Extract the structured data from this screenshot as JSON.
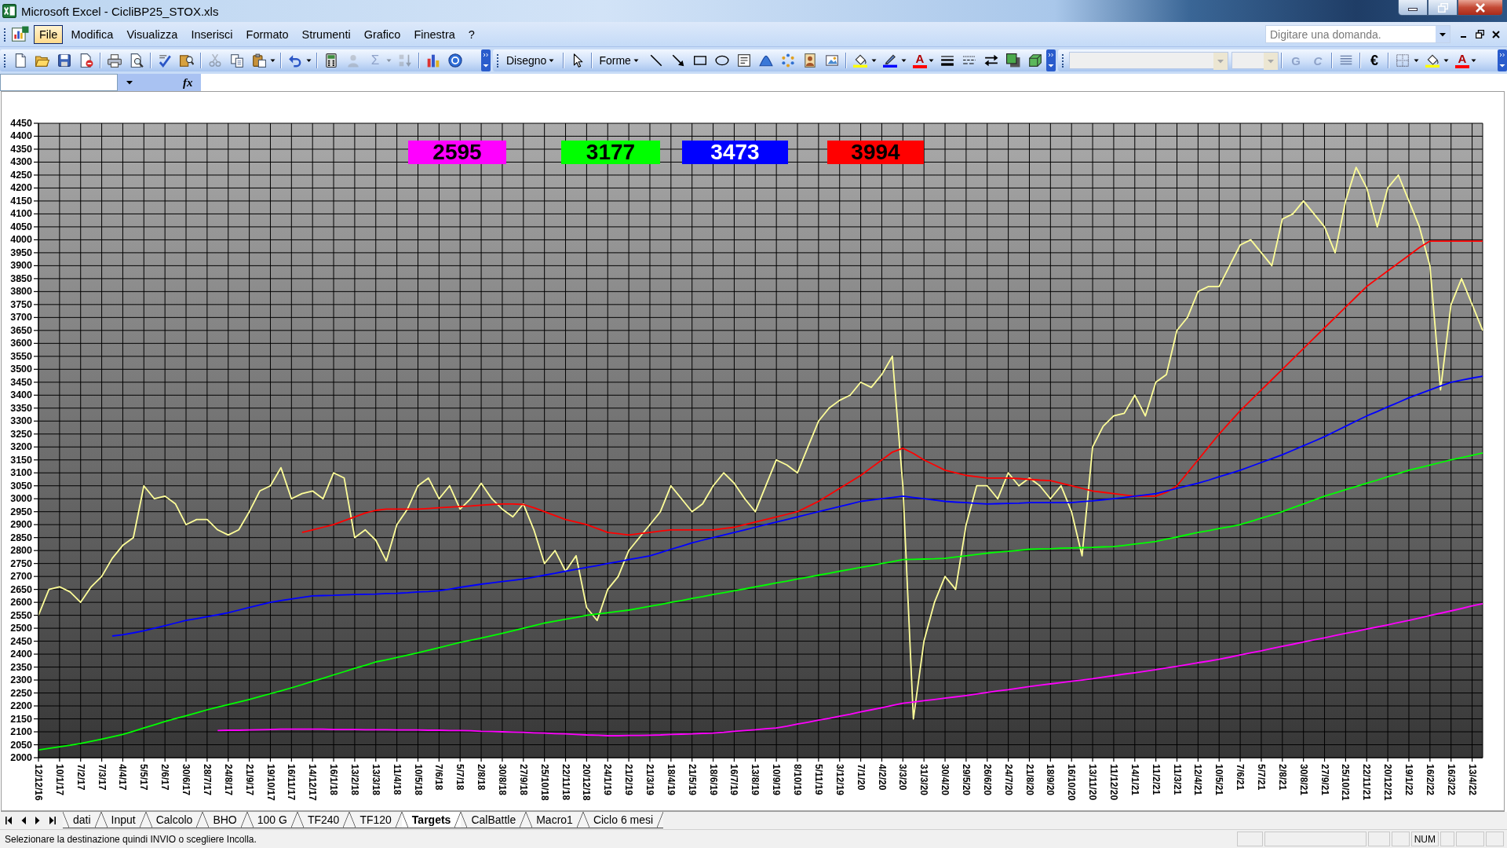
{
  "window": {
    "title": "Microsoft Excel - CicliBP25_STOX.xls"
  },
  "menu_bar": {
    "items": [
      {
        "label": "File",
        "selected": true
      },
      {
        "label": "Modifica",
        "selected": false
      },
      {
        "label": "Visualizza",
        "selected": false
      },
      {
        "label": "Inserisci",
        "selected": false
      },
      {
        "label": "Formato",
        "selected": false
      },
      {
        "label": "Strumenti",
        "selected": false
      },
      {
        "label": "Grafico",
        "selected": false
      },
      {
        "label": "Finestra",
        "selected": false
      },
      {
        "label": "?",
        "selected": false
      }
    ],
    "help_search": {
      "placeholder": "Digitare una domanda."
    }
  },
  "standard_toolbar": {
    "buttons": [
      {
        "disabled": false
      },
      {
        "disabled": false
      },
      {
        "disabled": false
      },
      {
        "disabled": false
      },
      {
        "disabled": false
      },
      {
        "disabled": false
      },
      {
        "disabled": false
      },
      {
        "disabled": false
      },
      {
        "disabled": true
      },
      {
        "disabled": false
      },
      {
        "disabled": false
      },
      {
        "disabled": false
      },
      {
        "disabled": false
      },
      {
        "disabled": false
      },
      {
        "disabled": false
      },
      {
        "disabled": true
      },
      {
        "text": "Σ",
        "disabled": true
      },
      {
        "disabled": true
      },
      {
        "disabled": true
      },
      {
        "disabled": false
      },
      {
        "disabled": false
      }
    ]
  },
  "drawing_toolbar": {
    "draw_menu": "Disegno",
    "shapes_menu": "Forme",
    "font_color": "A"
  },
  "formatting_toolbar": {
    "font_name": {
      "disabled": true
    },
    "font_size": {
      "disabled": true
    },
    "bold": {
      "text": "G",
      "disabled": true
    },
    "italic": {
      "text": "C",
      "disabled": true
    },
    "euro": "€",
    "font_color": "A"
  },
  "formula_bar": {
    "function_label": "fx"
  },
  "chart": {
    "value_tags": [
      {
        "text": "2595",
        "color": "#ff00ff"
      },
      {
        "text": "3177",
        "color": "#00ff00"
      },
      {
        "text": "3473",
        "color": "#0000ff"
      },
      {
        "text": "3994",
        "color": "#ff0000"
      }
    ],
    "chart_data": {
      "type": "line",
      "grid": true,
      "ylim": [
        2000,
        4450
      ],
      "categories": [
        "12/12/16",
        null,
        "10/1/17",
        null,
        "7/2/17",
        null,
        "7/3/17",
        null,
        "4/4/17",
        null,
        "5/5/17",
        null,
        "2/6/17",
        null,
        "30/6/17",
        null,
        "28/7/17",
        null,
        "24/8/17",
        null,
        "21/9/17",
        null,
        "19/10/17",
        null,
        "16/11/17",
        null,
        "14/12/17",
        null,
        "16/1/18",
        null,
        "13/2/18",
        null,
        "13/3/18",
        null,
        "11/4/18",
        null,
        "10/5/18",
        null,
        "7/6/18",
        null,
        "5/7/18",
        null,
        "2/8/18",
        null,
        "30/8/18",
        null,
        "27/9/18",
        null,
        "25/10/18",
        null,
        "22/11/18",
        null,
        "20/12/18",
        null,
        "24/1/19",
        null,
        "21/2/19",
        null,
        "21/3/19",
        null,
        "18/4/19",
        null,
        "21/5/19",
        null,
        "18/6/19",
        null,
        "16/7/19",
        null,
        "13/8/19",
        null,
        "10/9/19",
        null,
        "8/10/19",
        null,
        "5/11/19",
        null,
        "3/12/19",
        null,
        "7/1/20",
        null,
        "4/2/20",
        null,
        "3/3/20",
        null,
        "31/3/20",
        null,
        "30/4/20",
        null,
        "29/5/20",
        null,
        "26/6/20",
        null,
        "24/7/20",
        null,
        "21/8/20",
        null,
        "18/9/20",
        null,
        "16/10/20",
        null,
        "13/11/20",
        null,
        "11/12/20",
        null,
        "14/1/21",
        null,
        "11/2/21",
        null,
        "11/3/21",
        null,
        "12/4/21",
        null,
        "10/5/21",
        null,
        "7/6/21",
        null,
        "5/7/21",
        null,
        "2/8/21",
        null,
        "30/8/21",
        null,
        "27/9/21",
        null,
        "25/10/21",
        null,
        "22/11/21",
        null,
        "20/12/21",
        null,
        "19/1/22",
        null,
        "16/2/22",
        null,
        "16/3/22",
        null,
        "13/4/22",
        null
      ],
      "yticks": [
        2000,
        2050,
        2100,
        2150,
        2200,
        2250,
        2300,
        2350,
        2400,
        2450,
        2500,
        2550,
        2600,
        2650,
        2700,
        2750,
        2800,
        2850,
        2900,
        2950,
        3000,
        3050,
        3100,
        3150,
        3200,
        3250,
        3300,
        3350,
        3400,
        3450,
        3500,
        3550,
        3600,
        3650,
        3700,
        3750,
        3800,
        3850,
        3900,
        3950,
        4000,
        4050,
        4100,
        4150,
        4200,
        4250,
        4300,
        4350,
        4400,
        4450
      ],
      "series": [
        {
          "color": "#ffff99",
          "values": [
            2550,
            2650,
            2660,
            2640,
            2600,
            2660,
            2700,
            2770,
            2820,
            2850,
            3050,
            3000,
            3010,
            2980,
            2900,
            2920,
            2920,
            2880,
            2860,
            2880,
            2950,
            3030,
            3050,
            3120,
            3000,
            3020,
            3030,
            3000,
            3100,
            3080,
            2850,
            2880,
            2840,
            2760,
            2900,
            2960,
            3050,
            3080,
            3000,
            3050,
            2960,
            3000,
            3060,
            3000,
            2960,
            2930,
            2980,
            2880,
            2750,
            2800,
            2720,
            2780,
            2580,
            2530,
            2650,
            2700,
            2800,
            2850,
            2900,
            2950,
            3050,
            3000,
            2950,
            2980,
            3050,
            3100,
            3060,
            3000,
            2950,
            3050,
            3150,
            3130,
            3100,
            3200,
            3300,
            3350,
            3380,
            3400,
            3450,
            3430,
            3480,
            3550,
            3050,
            2150,
            2450,
            2600,
            2700,
            2650,
            2900,
            3050,
            3050,
            3000,
            3100,
            3050,
            3080,
            3050,
            3000,
            3050,
            2950,
            2780,
            3200,
            3280,
            3320,
            3330,
            3400,
            3320,
            3450,
            3480,
            3650,
            3700,
            3800,
            3820,
            3820,
            3900,
            3980,
            4000,
            3950,
            3900,
            4080,
            4100,
            4150,
            4100,
            4050,
            3950,
            4150,
            4280,
            4200,
            4050,
            4200,
            4250,
            4150,
            4050,
            3900,
            3420,
            3750,
            3850,
            3750,
            3650
          ]
        },
        {
          "color": "#ff0000",
          "values": [
            null,
            null,
            null,
            null,
            null,
            null,
            null,
            null,
            null,
            null,
            null,
            null,
            null,
            null,
            null,
            null,
            null,
            null,
            null,
            null,
            null,
            null,
            null,
            null,
            null,
            2870,
            2880,
            2890,
            2900,
            2915,
            2930,
            2945,
            2955,
            2960,
            2960,
            2960,
            2960,
            2962,
            2965,
            2968,
            2970,
            2972,
            2975,
            2978,
            2980,
            2980,
            2978,
            2965,
            2950,
            2935,
            2920,
            2910,
            2900,
            2885,
            2870,
            2865,
            2860,
            2865,
            2870,
            2875,
            2880,
            2880,
            2880,
            2880,
            2880,
            2885,
            2890,
            2900,
            2910,
            2920,
            2930,
            2940,
            2950,
            2970,
            2990,
            3015,
            3040,
            3065,
            3090,
            3120,
            3150,
            3180,
            3195,
            3175,
            3150,
            3130,
            3110,
            3100,
            3090,
            3085,
            3080,
            3080,
            3080,
            3078,
            3075,
            3072,
            3070,
            3060,
            3050,
            3040,
            3030,
            3025,
            3020,
            3015,
            3010,
            3010,
            3010,
            3025,
            3050,
            3100,
            3150,
            3200,
            3250,
            3295,
            3340,
            3380,
            3420,
            3460,
            3500,
            3540,
            3580,
            3620,
            3660,
            3700,
            3740,
            3780,
            3820,
            3850,
            3880,
            3910,
            3940,
            3970,
            3995,
            3995,
            3995,
            3995,
            3995,
            3995
          ]
        },
        {
          "color": "#0000ff",
          "values": [
            null,
            null,
            null,
            null,
            null,
            null,
            null,
            2470,
            2475,
            2482,
            2490,
            2500,
            2510,
            2520,
            2530,
            2537,
            2545,
            2552,
            2560,
            2570,
            2580,
            2590,
            2600,
            2607,
            2613,
            2619,
            2625,
            2626,
            2627,
            2629,
            2630,
            2631,
            2632,
            2634,
            2635,
            2637,
            2640,
            2642,
            2645,
            2651,
            2658,
            2664,
            2670,
            2675,
            2680,
            2685,
            2690,
            2697,
            2705,
            2712,
            2720,
            2727,
            2735,
            2742,
            2750,
            2757,
            2765,
            2772,
            2780,
            2792,
            2805,
            2817,
            2830,
            2840,
            2850,
            2860,
            2870,
            2880,
            2890,
            2900,
            2910,
            2920,
            2930,
            2940,
            2950,
            2960,
            2970,
            2980,
            2990,
            2995,
            3000,
            3005,
            3010,
            3005,
            3000,
            2995,
            2990,
            2987,
            2985,
            2982,
            2980,
            2981,
            2982,
            2983,
            2985,
            2985,
            2985,
            2985,
            2985,
            2989,
            2992,
            2996,
            3000,
            3005,
            3010,
            3015,
            3020,
            3030,
            3040,
            3050,
            3060,
            3072,
            3085,
            3097,
            3110,
            3125,
            3140,
            3155,
            3170,
            3187,
            3205,
            3222,
            3240,
            3260,
            3280,
            3300,
            3320,
            3337,
            3355,
            3372,
            3390,
            3405,
            3420,
            3435,
            3450,
            3458,
            3466,
            3473
          ]
        },
        {
          "color": "#00ff00",
          "values": [
            2030,
            2036,
            2042,
            2048,
            2055,
            2063,
            2072,
            2081,
            2090,
            2102,
            2115,
            2127,
            2140,
            2151,
            2162,
            2173,
            2185,
            2195,
            2205,
            2215,
            2225,
            2236,
            2247,
            2258,
            2270,
            2282,
            2295,
            2307,
            2320,
            2332,
            2345,
            2357,
            2370,
            2378,
            2387,
            2396,
            2405,
            2415,
            2425,
            2435,
            2445,
            2454,
            2462,
            2471,
            2480,
            2490,
            2500,
            2510,
            2520,
            2527,
            2535,
            2542,
            2550,
            2555,
            2560,
            2565,
            2570,
            2577,
            2585,
            2592,
            2600,
            2607,
            2615,
            2622,
            2630,
            2637,
            2645,
            2652,
            2660,
            2667,
            2675,
            2682,
            2690,
            2697,
            2705,
            2712,
            2720,
            2727,
            2735,
            2742,
            2750,
            2757,
            2765,
            2766,
            2767,
            2768,
            2770,
            2775,
            2780,
            2785,
            2790,
            2794,
            2797,
            2801,
            2805,
            2806,
            2807,
            2809,
            2810,
            2811,
            2812,
            2814,
            2815,
            2820,
            2825,
            2830,
            2835,
            2844,
            2852,
            2861,
            2870,
            2877,
            2885,
            2892,
            2900,
            2912,
            2925,
            2937,
            2950,
            2965,
            2980,
            2995,
            3010,
            3022,
            3035,
            3047,
            3060,
            3072,
            3085,
            3097,
            3110,
            3120,
            3130,
            3140,
            3150,
            3159,
            3168,
            3177
          ]
        },
        {
          "color": "#ff00ff",
          "values": [
            null,
            null,
            null,
            null,
            null,
            null,
            null,
            null,
            null,
            null,
            null,
            null,
            null,
            null,
            null,
            null,
            null,
            2105,
            2106,
            2106,
            2107,
            2108,
            2109,
            2110,
            2110,
            2110,
            2110,
            2110,
            2109,
            2109,
            2109,
            2108,
            2108,
            2108,
            2107,
            2107,
            2107,
            2106,
            2106,
            2105,
            2105,
            2104,
            2102,
            2101,
            2100,
            2099,
            2098,
            2096,
            2095,
            2093,
            2092,
            2090,
            2088,
            2087,
            2085,
            2085,
            2086,
            2086,
            2087,
            2088,
            2090,
            2091,
            2092,
            2094,
            2095,
            2098,
            2102,
            2105,
            2108,
            2112,
            2115,
            2122,
            2130,
            2137,
            2145,
            2152,
            2160,
            2168,
            2177,
            2185,
            2193,
            2202,
            2210,
            2215,
            2220,
            2225,
            2230,
            2235,
            2240,
            2246,
            2252,
            2258,
            2263,
            2269,
            2275,
            2280,
            2285,
            2290,
            2295,
            2300,
            2305,
            2311,
            2317,
            2323,
            2328,
            2334,
            2340,
            2347,
            2353,
            2360,
            2367,
            2373,
            2380,
            2388,
            2397,
            2405,
            2413,
            2422,
            2430,
            2438,
            2447,
            2455,
            2463,
            2472,
            2480,
            2488,
            2497,
            2505,
            2513,
            2522,
            2530,
            2539,
            2549,
            2558,
            2567,
            2576,
            2586,
            2595
          ]
        }
      ]
    }
  },
  "sheet_tabs": [
    {
      "label": "dati",
      "selected": false
    },
    {
      "label": "Input",
      "selected": false
    },
    {
      "label": "Calcolo",
      "selected": false
    },
    {
      "label": "BHO",
      "selected": false
    },
    {
      "label": "100 G",
      "selected": false
    },
    {
      "label": "TF240",
      "selected": false
    },
    {
      "label": "TF120",
      "selected": false
    },
    {
      "label": "Targets",
      "selected": true
    },
    {
      "label": "CalBattle",
      "selected": false
    },
    {
      "label": "Macro1",
      "selected": false
    },
    {
      "label": "Ciclo 6 mesi",
      "selected": false
    }
  ],
  "status_bar": {
    "message": "Selezionare la destinazione quindi INVIO o scegliere Incolla.",
    "indicators": [
      "NUM"
    ]
  }
}
